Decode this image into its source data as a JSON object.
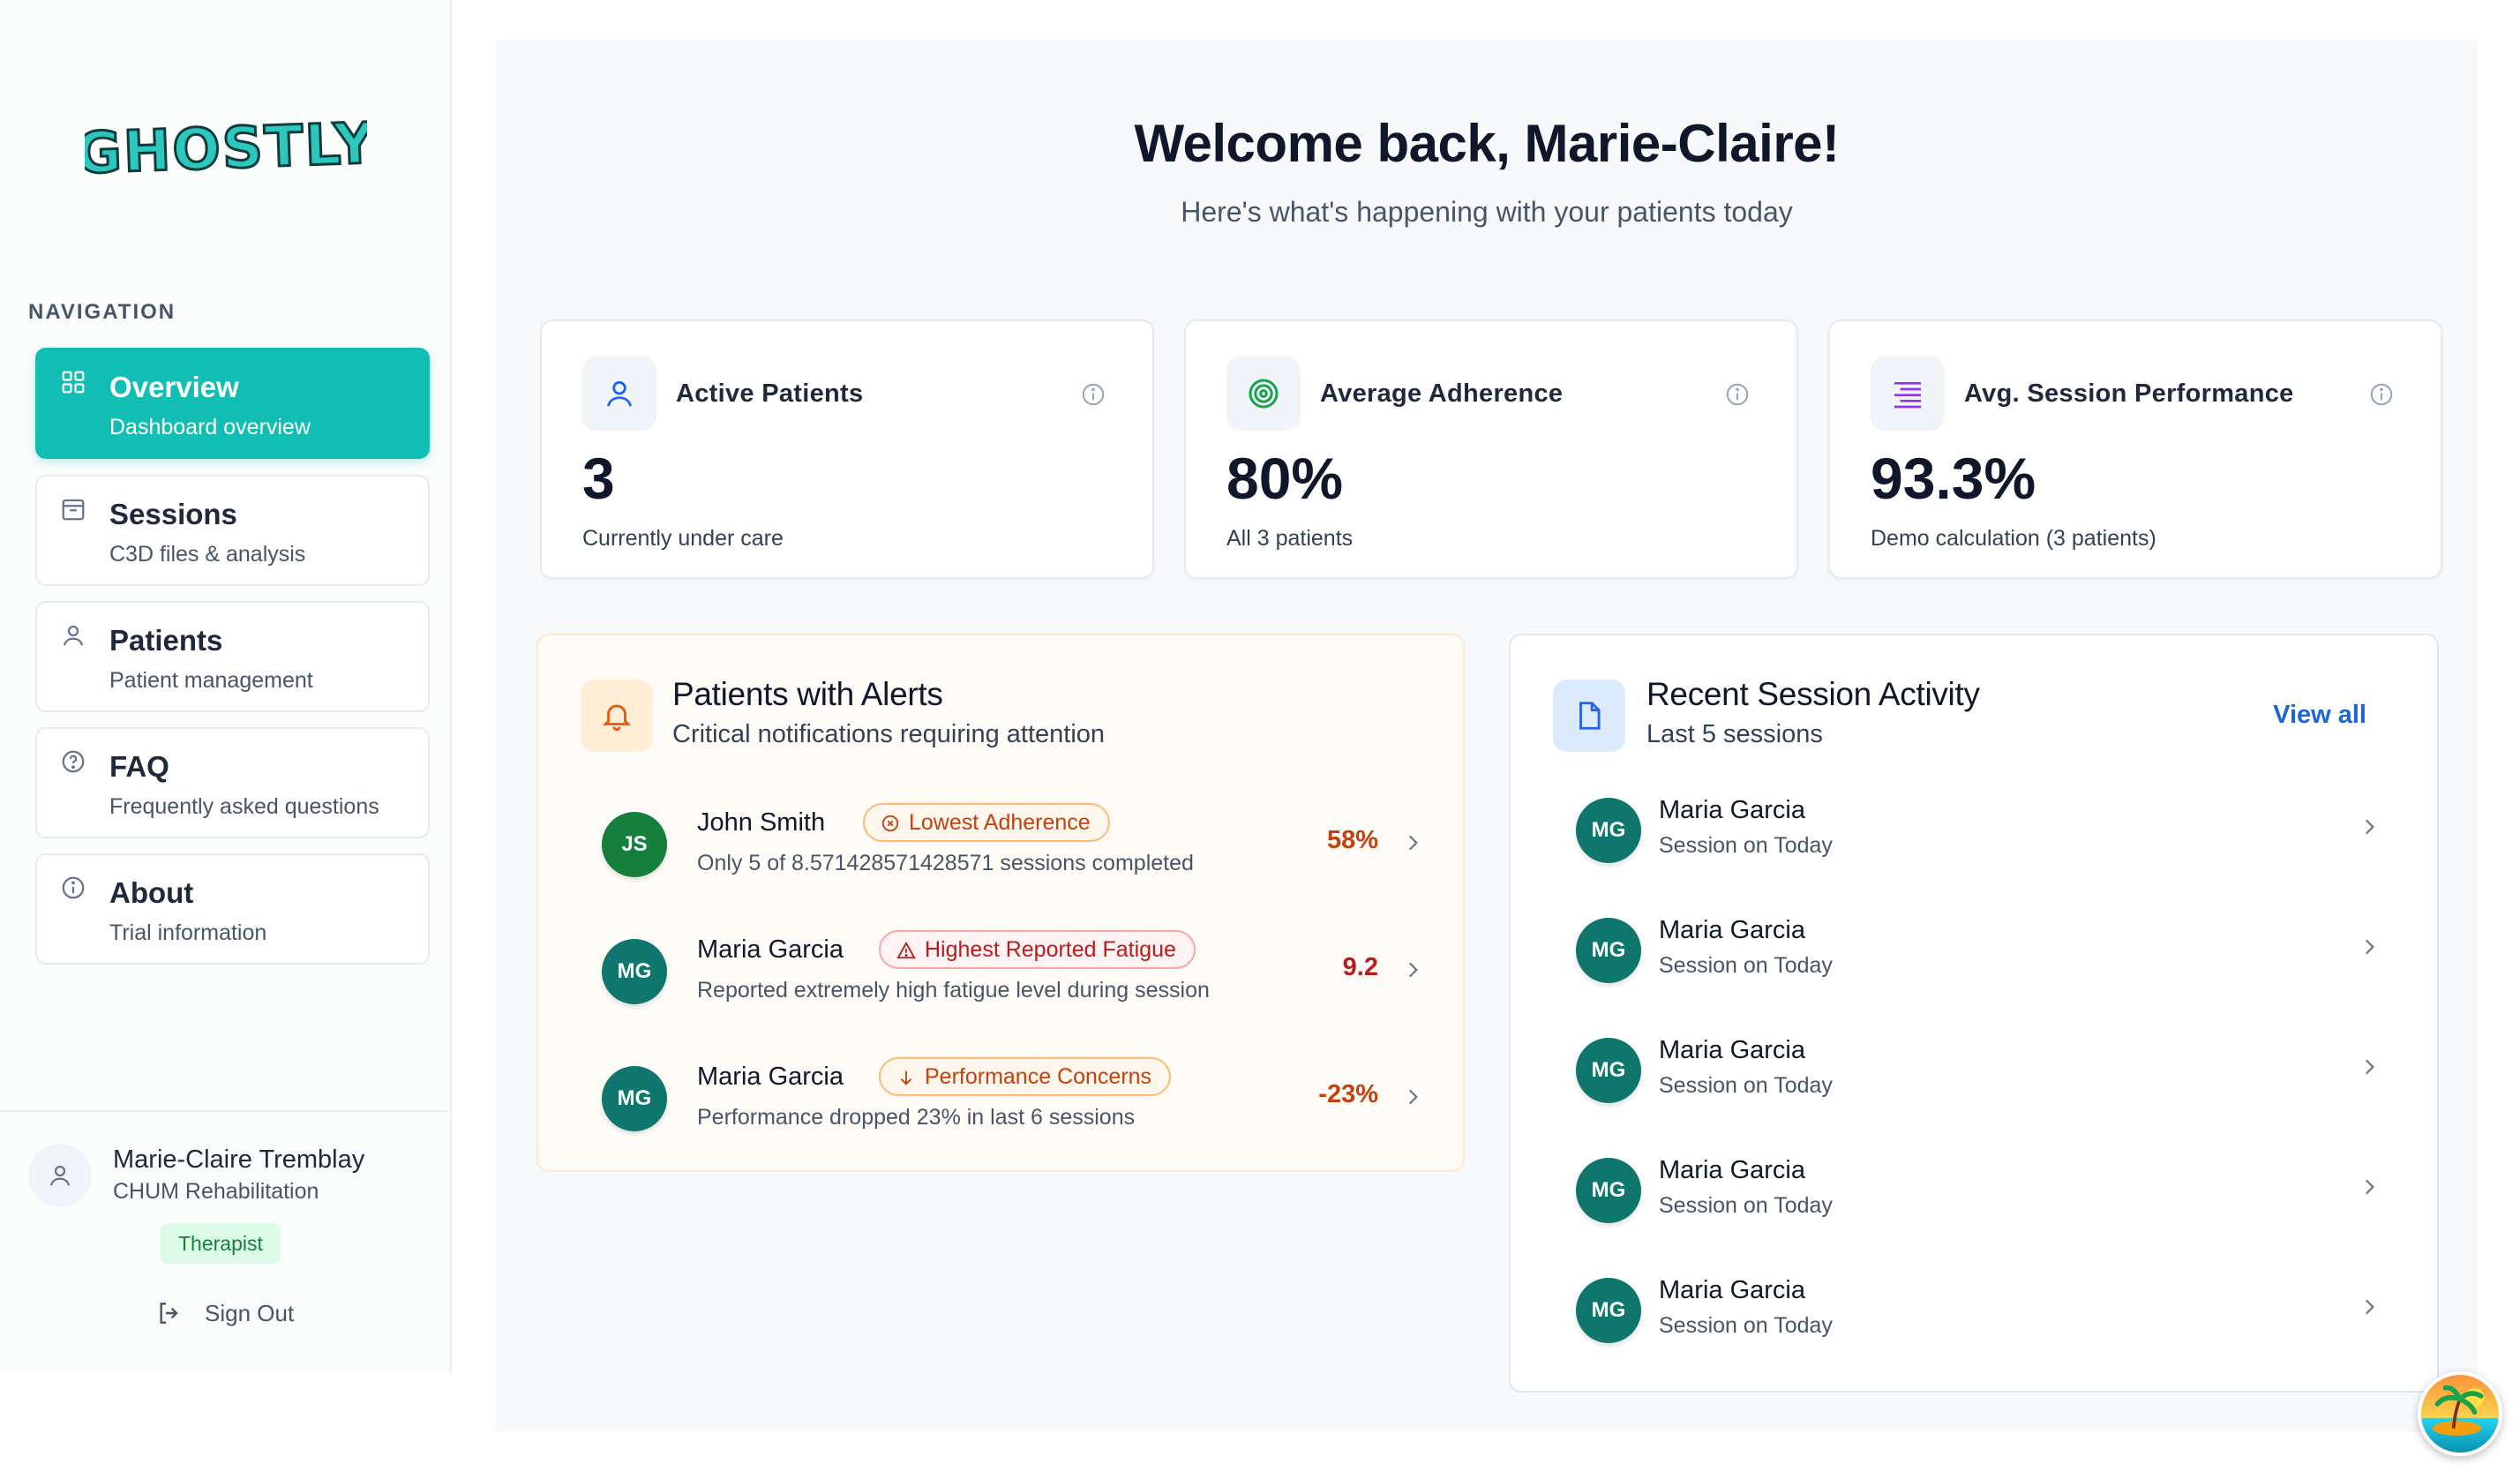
{
  "brand": {
    "logo_text": "GHOSTLY"
  },
  "sidebar": {
    "heading": "NAVIGATION",
    "items": [
      {
        "title": "Overview",
        "subtitle": "Dashboard overview",
        "icon": "grid-icon",
        "active": true
      },
      {
        "title": "Sessions",
        "subtitle": "C3D files & analysis",
        "icon": "archive-icon",
        "active": false
      },
      {
        "title": "Patients",
        "subtitle": "Patient management",
        "icon": "user-icon",
        "active": false
      },
      {
        "title": "FAQ",
        "subtitle": "Frequently asked questions",
        "icon": "help-circle-icon",
        "active": false
      },
      {
        "title": "About",
        "subtitle": "Trial information",
        "icon": "info-icon",
        "active": false
      }
    ],
    "user": {
      "name": "Marie-Claire Tremblay",
      "org": "CHUM Rehabilitation",
      "role": "Therapist"
    },
    "sign_out": "Sign Out"
  },
  "main": {
    "welcome": "Welcome back, Marie-Claire!",
    "subtitle": "Here's what's happening with your patients today",
    "stats": [
      {
        "label": "Active Patients",
        "value": "3",
        "sub": "Currently under care",
        "icon": "user-icon",
        "icon_color": "#2563eb"
      },
      {
        "label": "Average Adherence",
        "value": "80%",
        "sub": "All 3 patients",
        "icon": "target-icon",
        "icon_color": "#16a34a"
      },
      {
        "label": "Avg. Session Performance",
        "value": "93.3%",
        "sub": "Demo calculation (3 patients)",
        "icon": "list-icon",
        "icon_color": "#9333ea"
      }
    ],
    "alerts": {
      "title": "Patients with Alerts",
      "subtitle": "Critical notifications requiring attention",
      "items": [
        {
          "initials": "JS",
          "name": "John Smith",
          "badge": "Lowest Adherence",
          "badge_icon": "x-circle-icon",
          "desc": "Only 5 of 8.571428571428571 sessions completed",
          "value": "58%",
          "avatar_color": "#15803d"
        },
        {
          "initials": "MG",
          "name": "Maria Garcia",
          "badge": "Highest Reported Fatigue",
          "badge_icon": "warning-triangle-icon",
          "desc": "Reported extremely high fatigue level during session",
          "value": "9.2",
          "avatar_color": "#0f766e"
        },
        {
          "initials": "MG",
          "name": "Maria Garcia",
          "badge": "Performance Concerns",
          "badge_icon": "arrow-down-icon",
          "desc": "Performance dropped 23% in last 6 sessions",
          "value": "-23%",
          "avatar_color": "#0f766e"
        }
      ]
    },
    "recent": {
      "title": "Recent Session Activity",
      "subtitle": "Last 5 sessions",
      "view_all": "View all",
      "items": [
        {
          "initials": "MG",
          "name": "Maria Garcia",
          "sub": "Session on Today"
        },
        {
          "initials": "MG",
          "name": "Maria Garcia",
          "sub": "Session on Today"
        },
        {
          "initials": "MG",
          "name": "Maria Garcia",
          "sub": "Session on Today"
        },
        {
          "initials": "MG",
          "name": "Maria Garcia",
          "sub": "Session on Today"
        },
        {
          "initials": "MG",
          "name": "Maria Garcia",
          "sub": "Session on Today"
        }
      ]
    }
  },
  "colors": {
    "accent": "#12bdb3",
    "alert_value": "#c2410c",
    "link": "#1d64d8",
    "avatar": "#0f766e"
  }
}
